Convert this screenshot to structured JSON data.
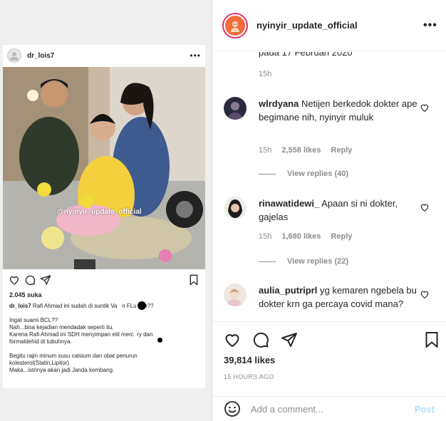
{
  "media": {
    "inner_post": {
      "username": "dr_lois7",
      "more": "•••",
      "watermark": "@nyinyir_update_official",
      "likes": "2.045 suka",
      "caption_user": "dr_lois7",
      "caption_first": "Rafi Ahmad ini sudah di suntik Va   n FLu kan??",
      "caption_rest": "Ingat suami BCL??\nNah...bisa kejadian mendadak seperti itu.\nKarena Rafi Ahmad ini SDH menyimpan etil merc  ry dan\nformaldehid di tubuhnya.\n\nBegitu rajin minum susu calsium dan obat penurun\nkolesterol(Statin,Lipitor)\nMaka...istrinya akan jadi Janda kembang."
    }
  },
  "panel": {
    "header": {
      "username": "nyinyir_update_official",
      "more": "•••"
    },
    "previous_comment": {
      "text": "pada 17 Februari 2020",
      "time": "15h"
    },
    "comments": [
      {
        "username": "wlrdyana",
        "text": "Netijen berkedok dokter ape begimane nih, nyinyir muluk",
        "time": "15h",
        "likes": "2,558 likes",
        "reply": "Reply",
        "view_replies": "View replies (40)"
      },
      {
        "username": "rinawatidewi_",
        "text": "Apaan si ni dokter, gajelas",
        "time": "15h",
        "likes": "1,680 likes",
        "reply": "Reply",
        "view_replies": "View replies (22)"
      },
      {
        "username": "aulia_putriprl",
        "text": "yg kemaren ngebela bu dokter krn ga percaya covid mana?"
      }
    ],
    "likes_count": "39,814 likes",
    "time_ago": "15 HOURS AGO",
    "add_comment": {
      "placeholder": "Add a comment...",
      "post_label": "Post"
    }
  },
  "colors": {
    "post_button": "#b2dffc",
    "avatar_ring": "#e1306c",
    "secondary_text": "#8e8e8e"
  }
}
